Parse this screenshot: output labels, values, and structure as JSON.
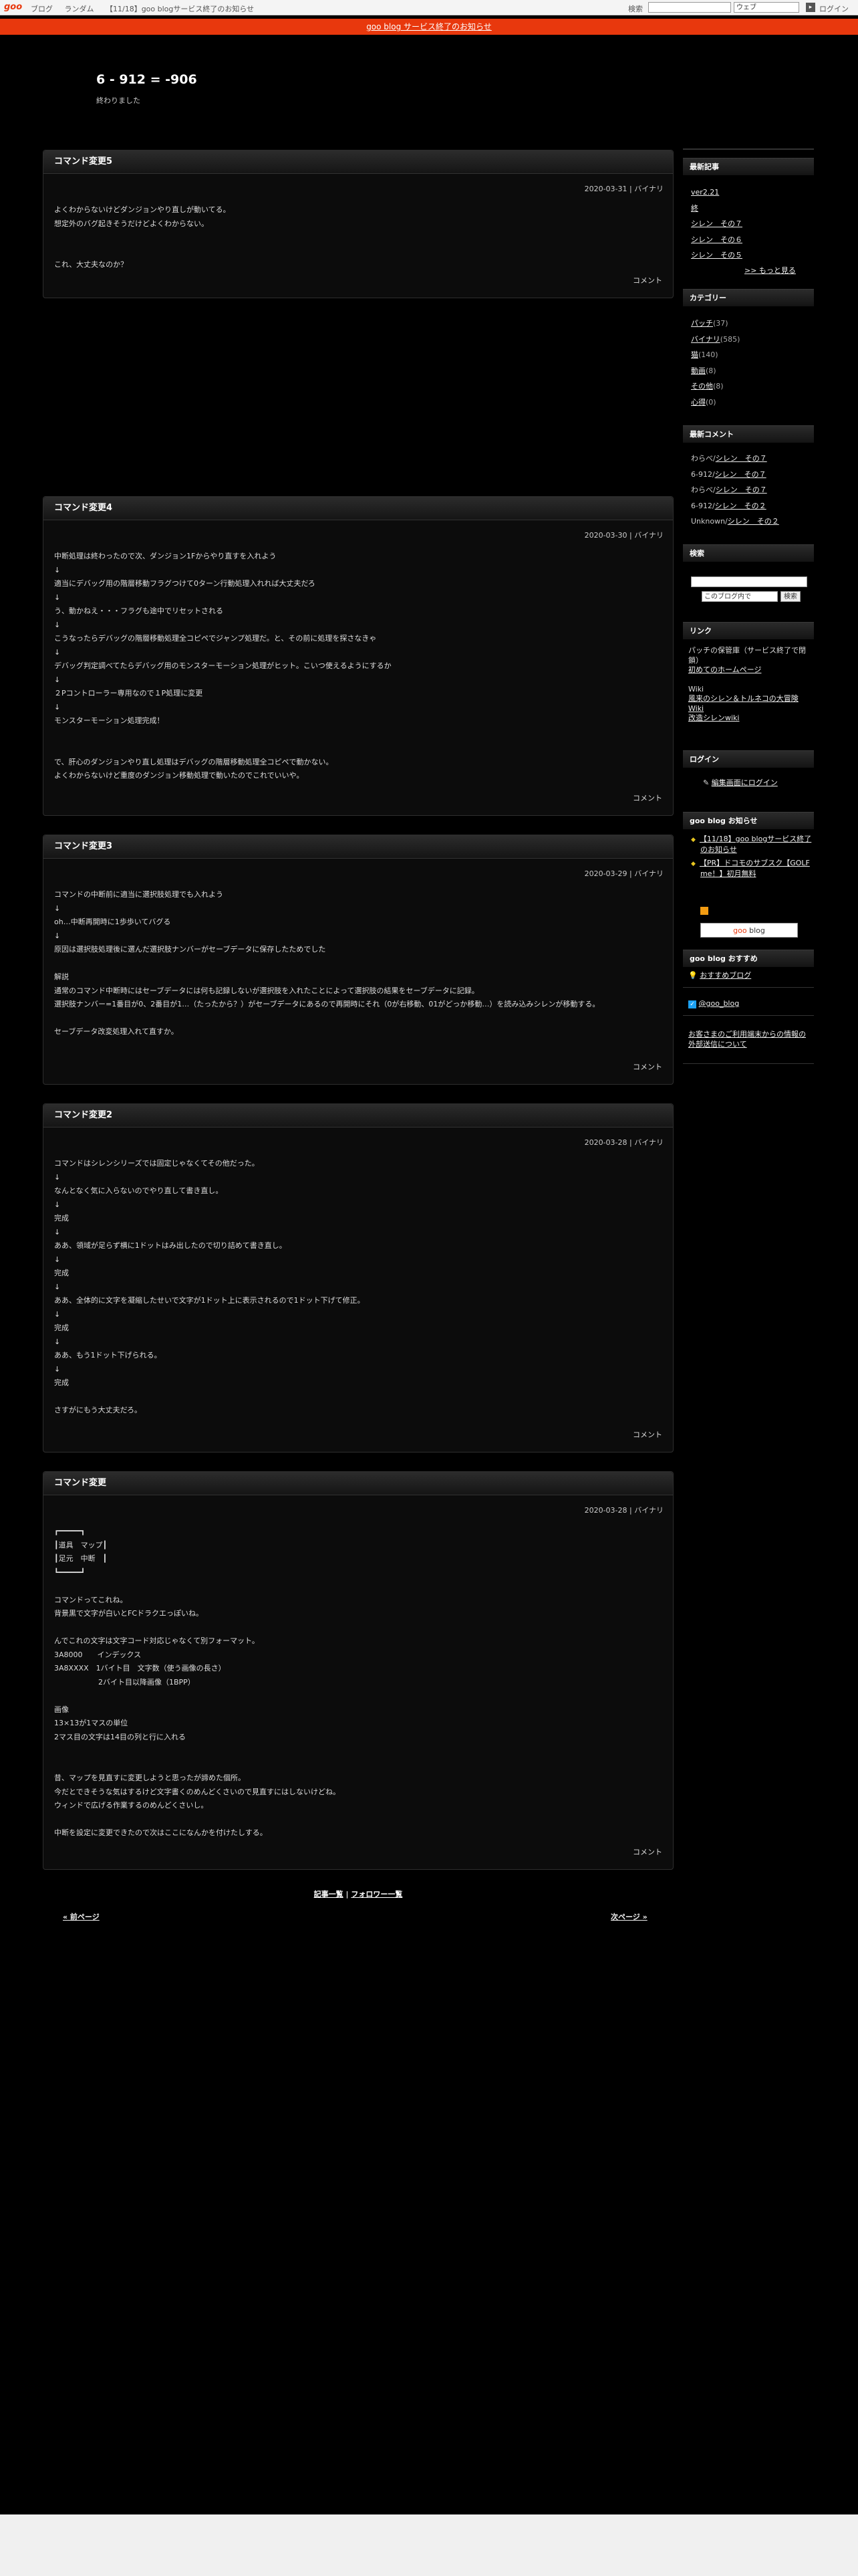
{
  "topbar": {
    "logo": "goo",
    "links": [
      "ブログ",
      "ランダム",
      "【11/18】goo blogサービス終了のお知らせ"
    ],
    "search_label": "検索",
    "search_value": "",
    "scope_option": "ウェブ",
    "login": "ログイン"
  },
  "notice": "goo blog サービス終了のお知らせ",
  "header": {
    "title": "6 - 912 = -906",
    "description": "終わりました"
  },
  "comment_label": "コメント",
  "entries": [
    {
      "title": "コマンド変更5",
      "meta": "2020-03-31 | バイナリ",
      "body": "よくわからないけどダンジョンやり直しが動いてる。\n想定外のバグ起きそうだけどよくわからない。\n\n\nこれ、大丈夫なのか？"
    },
    {
      "title": "コマンド変更4",
      "meta": "2020-03-30 | バイナリ",
      "body": "中断処理は終わったので次、ダンジョン1Fからやり直すを入れよう\n↓\n適当にデバッグ用の階層移動フラグつけて0ターン行動処理入れれば大丈夫だろ\n↓\nう、動かねえ・・・フラグも途中でリセットされる\n↓\nこうなったらデバッグの階層移動処理全コピペでジャンプ処理だ。と、その前に処理を探さなきゃ\n↓\nデバッグ判定調べてたらデバッグ用のモンスターモーション処理がヒット。こいつ使えるようにするか\n↓\n２Pコントローラー専用なので１P処理に変更\n↓\nモンスターモーション処理完成！\n\n\nで、肝心のダンジョンやり直し処理はデバッグの階層移動処理全コピペで動かない。\nよくわからないけど重度のダンジョン移動処理で動いたのでこれでいいや。"
    },
    {
      "title": "コマンド変更3",
      "meta": "2020-03-29 | バイナリ",
      "body": "コマンドの中断前に適当に選択肢処理でも入れよう\n↓\noh…中断再開時に1歩歩いてバグる\n↓\n原因は選択肢処理後に選んだ選択肢ナンバーがセーブデータに保存したためでした\n\n解説\n通常のコマンド中断時にはセーブデータには何も記録しないが選択肢を入れたことによって選択肢の結果をセーブデータに記録。\n選択肢ナンバー=1番目が0、2番目が1…（たったから？）がセーブデータにあるので再開時にそれ（0が右移動、01がどっか移動…）を読み込みシレンが移動する。\n\nセーブデータ改変処理入れて直すか。"
    },
    {
      "title": "コマンド変更2",
      "meta": "2020-03-28 | バイナリ",
      "body": "コマンドはシレンシリーズでは固定じゃなくてその他だった。\n↓\nなんとなく気に入らないのでやり直して書き直し。\n↓\n完成\n↓\nああ、領域が足らず横に1ドットはみ出したので切り詰めて書き直し。\n↓\n完成\n↓\nああ、全体的に文字を凝縮したせいで文字が1ドット上に表示されるので1ドット下げて修正。\n↓\n完成\n↓\nああ、もう1ドット下げられる。\n↓\n完成\n\nさすがにもう大丈夫だろ。"
    },
    {
      "title": "コマンド変更",
      "meta": "2020-03-28 | バイナリ",
      "body": "┏━━━━━┓\n┃道具　マップ┃\n┃足元　中断　┃\n┗━━━━━┛\n\nコマンドってこれね。\n背景黒で文字が白いとFCドラクエっぽいね。\n\nんでこれの文字は文字コード対応じゃなくて別フォーマット。\n3A8000　　インデックス\n3A8XXXX　1バイト目　文字数（使う画像の長さ）\n　　　　　　2バイト目以降画像（1BPP）\n\n画像\n13×13が1マスの単位\n2マス目の文字は14目の列と行に入れる\n\n\n昔、マップを見直すに変更しようと思ったが諦めた個所。\n今だとできそうな気はするけど文字書くのめんどくさいので見直すにはしないけどね。\nウィンドで広げる作業するのめんどくさいし。\n\n中断を設定に変更できたので次はここになんかを付けたしする。"
    }
  ],
  "pager": {
    "articles": "記事一覧",
    "followers": "フォロワー一覧",
    "prev": "« 前ページ",
    "next": "次ページ »"
  },
  "sidebar": {
    "recent_title": "最新記事",
    "recent": [
      "ver2.21",
      "終",
      "シレン　その７",
      "シレン　その６",
      "シレン　その５"
    ],
    "more": ">> もっと見る",
    "category_title": "カテゴリー",
    "categories": [
      {
        "name": "パッチ",
        "count": "(37)"
      },
      {
        "name": "バイナリ",
        "count": "(585)"
      },
      {
        "name": "猫",
        "count": "(140)"
      },
      {
        "name": "動画",
        "count": "(8)"
      },
      {
        "name": "その他",
        "count": "(8)"
      },
      {
        "name": "心得",
        "count": "(0)"
      }
    ],
    "comments_title": "最新コメント",
    "comments": [
      {
        "who": "わらべ/",
        "post": "シレン　その７"
      },
      {
        "who": "6-912/",
        "post": "シレン　その７"
      },
      {
        "who": "わらべ/",
        "post": "シレン　その７"
      },
      {
        "who": "6-912/",
        "post": "シレン　その２"
      },
      {
        "who": "Unknown/",
        "post": "シレン　その２"
      }
    ],
    "search_title": "検索",
    "search_scope": "このブログ内で",
    "search_button": "検索",
    "links_title": "リンク",
    "links_desc1": "パッチの保管庫（サービス終了で閉鎖）",
    "links_1": "初めてのホームページ",
    "links_desc2": "Wiki",
    "links_2": "風来のシレン＆トルネコの大冒険 Wiki",
    "links_3": "改造シレンwiki",
    "login_title": "ログイン",
    "login_link": "編集画面にログイン",
    "notice_title": "goo blog お知らせ",
    "notice_1": "【11/18】goo blogサービス終了のお知らせ",
    "notice_2": "【PR】ドコモのサブスク【GOLF me！】初月無料",
    "goo_btn_g": "goo",
    "goo_btn_rest": " blog",
    "recommend_title": "goo blog おすすめ",
    "recommend_1": "おすすめブログ",
    "twitter": "@goo_blog",
    "external_link": "お客さまのご利用端末からの情報の外部送信について"
  }
}
